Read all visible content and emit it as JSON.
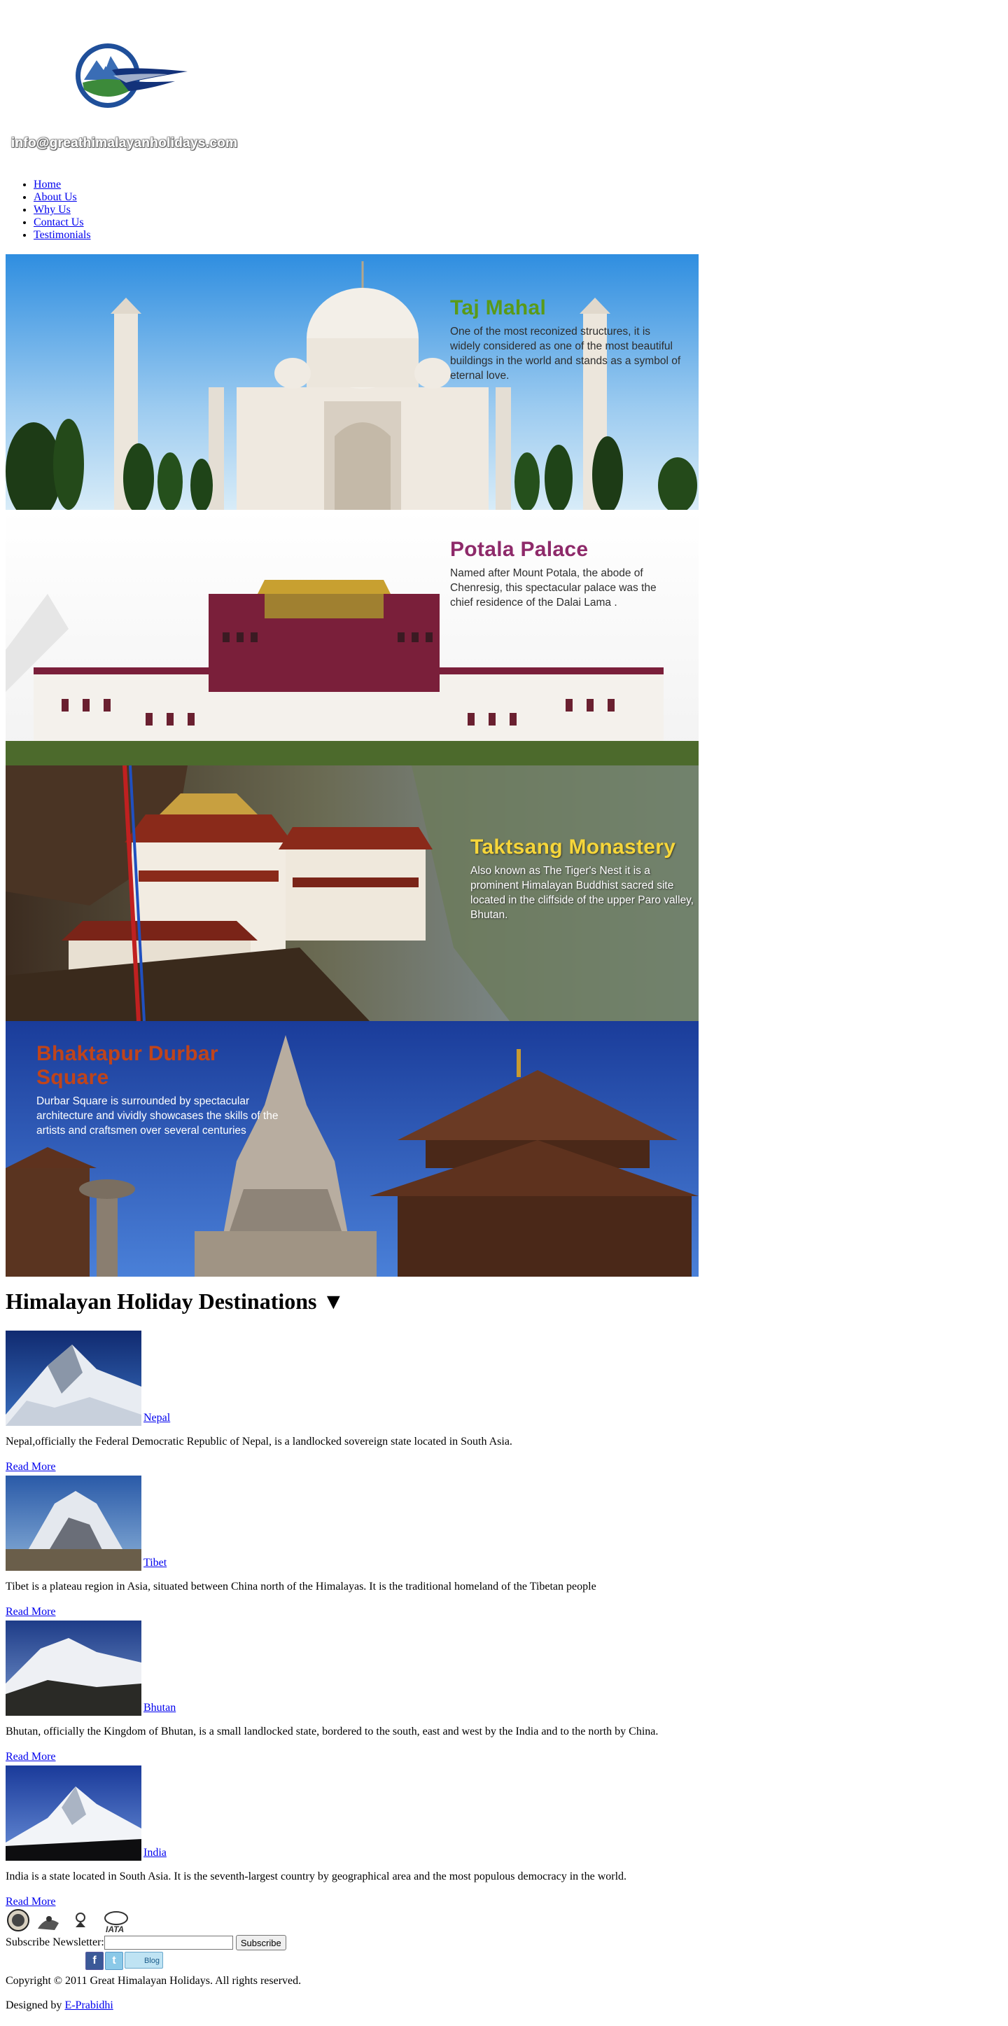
{
  "header": {
    "email_image_text": "info@greathimalayanholidays.com"
  },
  "nav": {
    "items": [
      {
        "label": "Home"
      },
      {
        "label": "About Us"
      },
      {
        "label": "Why Us"
      },
      {
        "label": "Contact Us"
      },
      {
        "label": "Testimonials"
      }
    ]
  },
  "slides": [
    {
      "title": "Taj Mahal",
      "description": "One of the most reconized structures, it is widely considered as one of the most beautiful buildings in the world and stands as a symbol of eternal love."
    },
    {
      "title": "Potala Palace",
      "description": "Named after Mount Potala, the abode of Chenresig, this spectacular palace was the chief residence of the Dalai Lama ."
    },
    {
      "title": "Taktsang Monastery",
      "description": "Also known as The Tiger's Nest it is a prominent Himalayan Buddhist sacred site located in the cliffside of the upper Paro valley, Bhutan."
    },
    {
      "title": "Bhaktapur Durbar Square",
      "description": "Durbar Square is surrounded by spectacular architecture and vividly showcases the skills of the artists and craftsmen over several centuries"
    }
  ],
  "destinations": {
    "heading": "Himalayan Holiday Destinations ▼",
    "items": [
      {
        "name": "Nepal",
        "description": "Nepal,officially the Federal Democratic Republic of Nepal, is a landlocked sovereign state located in South Asia.",
        "read_more": "Read More"
      },
      {
        "name": "Tibet",
        "description": "Tibet is a plateau region in Asia, situated between China north of the Himalayas. It is the traditional homeland of the Tibetan people",
        "read_more": "Read More"
      },
      {
        "name": "Bhutan",
        "description": "Bhutan, officially the Kingdom of Bhutan, is a small landlocked state, bordered to the south, east and west by the India and to the north by China.",
        "read_more": "Read More"
      },
      {
        "name": "India",
        "description": "India is a state located in South Asia. It is the seventh-largest country by geographical area and the most populous democracy in the world.",
        "read_more": "Read More"
      }
    ]
  },
  "affiliations": {
    "iata_text": "IATA"
  },
  "newsletter": {
    "label": "Subscribe Newsletter:",
    "input_value": "",
    "button_label": "Subscribe"
  },
  "social": {
    "facebook_glyph": "f",
    "twitter_glyph": "t",
    "blog_label": "Blog"
  },
  "footer": {
    "copyright": "Copyright © 2011 Great Himalayan Holidays. All rights reserved.",
    "designed_by_prefix": "Designed by ",
    "designer_link": "E-Prabidhi"
  }
}
